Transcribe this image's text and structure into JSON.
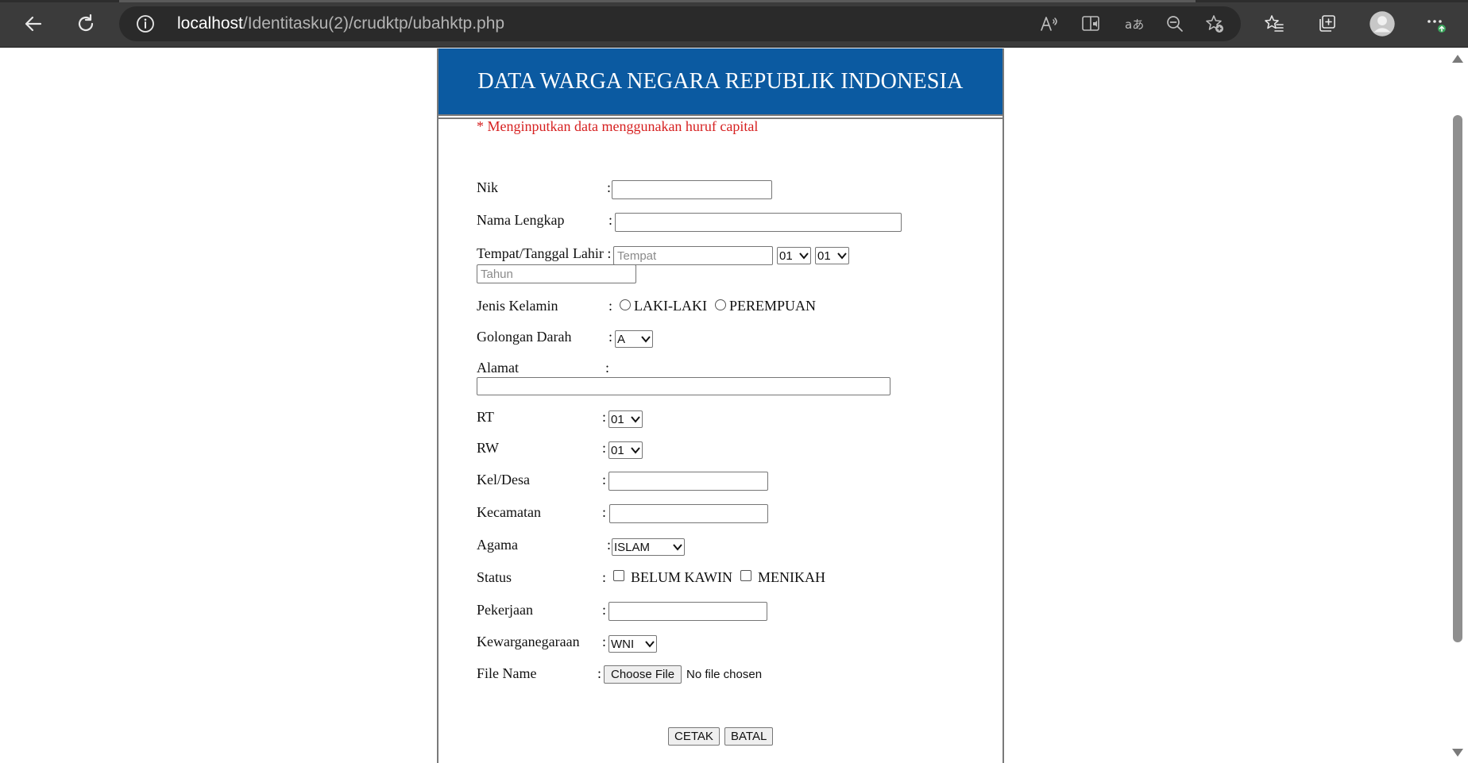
{
  "browser": {
    "url_host": "localhost",
    "url_path": "/Identitasku(2)/crudktp/ubahktp.php",
    "icons": [
      "back-arrow-icon",
      "refresh-icon",
      "info-icon",
      "read-aloud-icon",
      "immersive-reader-icon",
      "translate-icon",
      "zoom-out-icon",
      "add-favorite-icon",
      "favorites-icon",
      "collections-icon",
      "profile-icon",
      "more-icon"
    ]
  },
  "form": {
    "title": "DATA WARGA NEGARA REPUBLIK INDONESIA",
    "note": "* Menginputkan data menggunakan huruf capital",
    "colon": ":",
    "nik_label": "Nik",
    "nama_label": "Nama Lengkap",
    "ttl_label": "Tempat/Tanggal Lahir",
    "tempat_placeholder": "Tempat",
    "tanggal_value": "01",
    "bulan_value": "01",
    "tahun_placeholder": "Tahun",
    "jk_label": "Jenis Kelamin",
    "jk_opt1": "LAKI-LAKI",
    "jk_opt2": "PEREMPUAN",
    "goldar_label": "Golongan Darah",
    "goldar_value": "A",
    "alamat_label": "Alamat",
    "rt_label": "RT",
    "rt_value": "01",
    "rw_label": "RW",
    "rw_value": "01",
    "kel_label": "Kel/Desa",
    "kec_label": "Kecamatan",
    "agama_label": "Agama",
    "agama_value": "ISLAM",
    "status_label": "Status",
    "status_opt1": "BELUM KAWIN",
    "status_opt2": "MENIKAH",
    "pekerjaan_label": "Pekerjaan",
    "kwn_label": "Kewarganegaraan",
    "kwn_value": "WNI",
    "file_label": "File Name",
    "file_button": "Choose File",
    "file_status": "No file chosen",
    "cetak_button": "CETAK",
    "batal_button": "BATAL"
  },
  "colors": {
    "banner": "#0b5aa1",
    "note": "#d62020",
    "chrome": "#3b3b3b"
  }
}
